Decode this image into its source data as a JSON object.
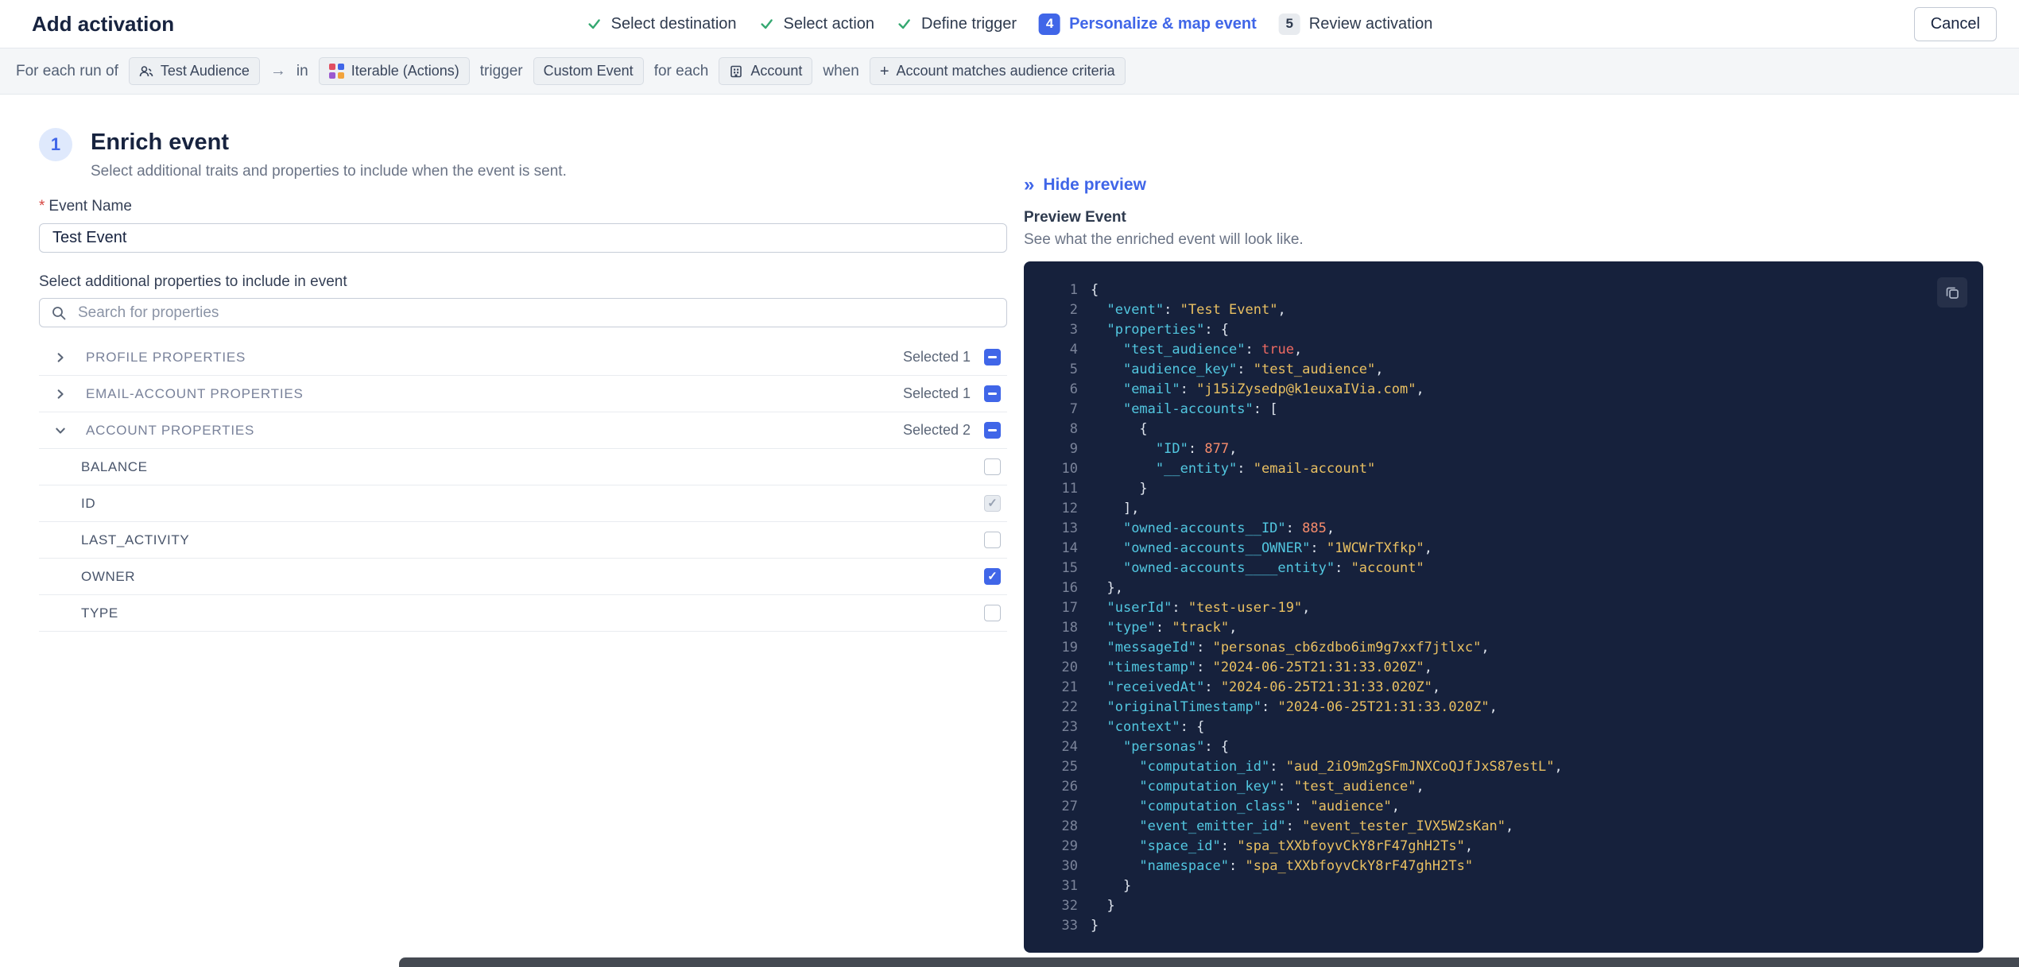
{
  "colors": {
    "accent_blue": "#4066e8",
    "success_green": "#35a871",
    "panel_bg": "#16213c",
    "code_key": "#52c7e0",
    "code_string": "#e9c062",
    "code_number": "#f78c6c",
    "code_boolean": "#ef6a62",
    "code_line_number": "#7b849a"
  },
  "icons": {
    "check": "check-mark",
    "arrow_right": "→",
    "collapse": "»",
    "plus": "+",
    "search": "magnifier",
    "copy": "copy-rects",
    "audience": "people",
    "iterable": "dot-grid",
    "account": "building",
    "chevron_right": "chevron-right",
    "chevron_down": "chevron-down"
  },
  "header": {
    "title": "Add activation",
    "cancel_label": "Cancel",
    "steps": [
      {
        "label": "Select destination",
        "state": "done"
      },
      {
        "label": "Select action",
        "state": "done"
      },
      {
        "label": "Define trigger",
        "state": "done"
      },
      {
        "number": "4",
        "label": "Personalize & map event",
        "state": "current"
      },
      {
        "number": "5",
        "label": "Review activation",
        "state": "upcoming"
      }
    ]
  },
  "trigger_bar": {
    "for_each_run_of": "For each run of",
    "audience_badge": "Test Audience",
    "arrow": "→",
    "in_label": "in",
    "destination_badge": "Iterable (Actions)",
    "trigger_label": "trigger",
    "event_badge": "Custom Event",
    "for_each_label": "for each",
    "entity_badge": "Account",
    "when_label": "when",
    "criteria_plus": "+",
    "criteria_badge": "Account matches audience criteria"
  },
  "enrich": {
    "step_number": "1",
    "title": "Enrich event",
    "subtitle": "Select additional traits and properties to include when the event is sent.",
    "required_marker": "*",
    "event_name_label": "Event Name",
    "event_name_value": "Test Event",
    "properties_label": "Select additional properties to include in event",
    "search_placeholder": "Search for properties",
    "groups": [
      {
        "label": "PROFILE PROPERTIES",
        "selected_text": "Selected 1",
        "expanded": false,
        "checkbox": "indeterminate"
      },
      {
        "label": "EMAIL-ACCOUNT PROPERTIES",
        "selected_text": "Selected 1",
        "expanded": false,
        "checkbox": "indeterminate"
      },
      {
        "label": "ACCOUNT PROPERTIES",
        "selected_text": "Selected 2",
        "expanded": true,
        "checkbox": "indeterminate",
        "items": [
          {
            "label": "BALANCE",
            "checkbox": "unchecked"
          },
          {
            "label": "ID",
            "checkbox": "checked-disabled"
          },
          {
            "label": "LAST_ACTIVITY",
            "checkbox": "unchecked"
          },
          {
            "label": "OWNER",
            "checkbox": "checked"
          },
          {
            "label": "TYPE",
            "checkbox": "unchecked"
          }
        ]
      }
    ]
  },
  "preview": {
    "hide_label": "Hide preview",
    "title": "Preview Event",
    "subtitle": "See what the enriched event will look like.",
    "code_lines": [
      "{",
      "  \"event\": \"Test Event\",",
      "  \"properties\": {",
      "    \"test_audience\": true,",
      "    \"audience_key\": \"test_audience\",",
      "    \"email\": \"j15iZysedp@k1euxaIVia.com\",",
      "    \"email-accounts\": [",
      "      {",
      "        \"ID\": 877,",
      "        \"__entity\": \"email-account\"",
      "      }",
      "    ],",
      "    \"owned-accounts__ID\": 885,",
      "    \"owned-accounts__OWNER\": \"1WCWrTXfkp\",",
      "    \"owned-accounts____entity\": \"account\"",
      "  },",
      "  \"userId\": \"test-user-19\",",
      "  \"type\": \"track\",",
      "  \"messageId\": \"personas_cb6zdbo6im9g7xxf7jtlxc\",",
      "  \"timestamp\": \"2024-06-25T21:31:33.020Z\",",
      "  \"receivedAt\": \"2024-06-25T21:31:33.020Z\",",
      "  \"originalTimestamp\": \"2024-06-25T21:31:33.020Z\",",
      "  \"context\": {",
      "    \"personas\": {",
      "      \"computation_id\": \"aud_2iO9m2gSFmJNXCoQJfJxS87estL\",",
      "      \"computation_key\": \"test_audience\",",
      "      \"computation_class\": \"audience\",",
      "      \"event_emitter_id\": \"event_tester_IVX5W2sKan\",",
      "      \"space_id\": \"spa_tXXbfoyvCkY8rF47ghH2Ts\",",
      "      \"namespace\": \"spa_tXXbfoyvCkY8rF47ghH2Ts\"",
      "    }",
      "  }",
      "}"
    ]
  }
}
